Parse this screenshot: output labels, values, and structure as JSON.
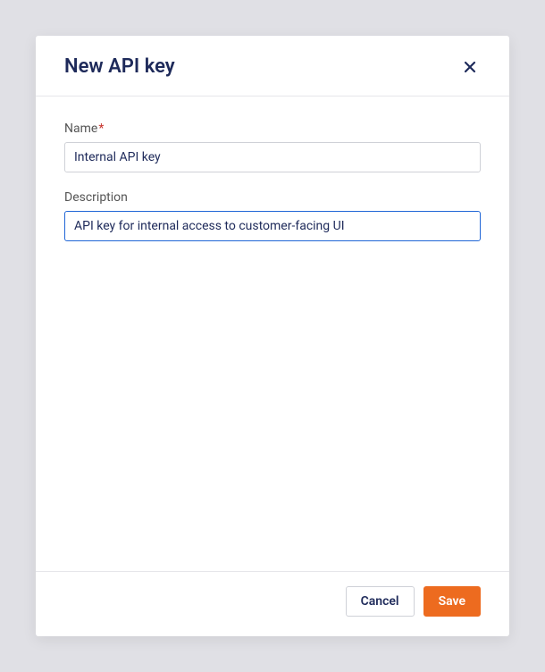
{
  "modal": {
    "title": "New API key",
    "fields": {
      "name": {
        "label": "Name",
        "required_marker": "*",
        "value": "Internal API key"
      },
      "description": {
        "label": "Description",
        "value": "API key for internal access to customer-facing UI"
      }
    },
    "buttons": {
      "cancel": "Cancel",
      "save": "Save"
    }
  }
}
